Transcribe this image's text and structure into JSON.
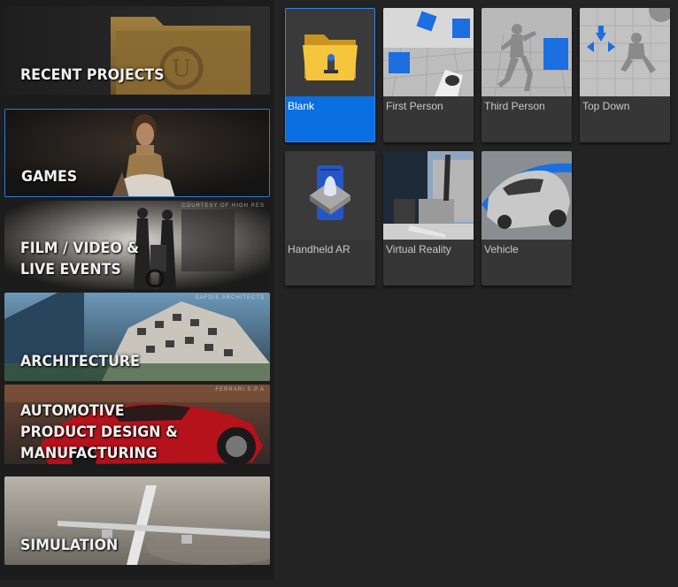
{
  "categories": [
    {
      "label_lines": [
        "RECENT PROJECTS"
      ],
      "credit": ""
    },
    {
      "label_lines": [
        "GAMES"
      ],
      "credit": ""
    },
    {
      "label_lines": [
        "FILM / VIDEO &",
        "LIVE EVENTS"
      ],
      "credit": "COURTESY OF HIGH RES"
    },
    {
      "label_lines": [
        "ARCHITECTURE"
      ],
      "credit": "SAFDIE ARCHITECTS"
    },
    {
      "label_lines": [
        "AUTOMOTIVE",
        "PRODUCT DESIGN &",
        "MANUFACTURING"
      ],
      "credit": "FERRARI S.P.A"
    },
    {
      "label_lines": [
        "SIMULATION"
      ],
      "credit": ""
    }
  ],
  "selected_category": "GAMES",
  "templates": [
    {
      "label": "Blank",
      "icon": "folder-icon"
    },
    {
      "label": "First Person",
      "icon": "first-person-thumbnail"
    },
    {
      "label": "Third Person",
      "icon": "third-person-thumbnail"
    },
    {
      "label": "Top Down",
      "icon": "top-down-thumbnail"
    },
    {
      "label": "Handheld AR",
      "icon": "handheld-ar-icon"
    },
    {
      "label": "Virtual Reality",
      "icon": "virtual-reality-thumbnail"
    },
    {
      "label": "Vehicle",
      "icon": "vehicle-thumbnail"
    }
  ],
  "selected_template": "Blank",
  "colors": {
    "selection_blue": "#0a6fe0",
    "panel_bg": "#232323",
    "tile_bg": "#363636"
  }
}
